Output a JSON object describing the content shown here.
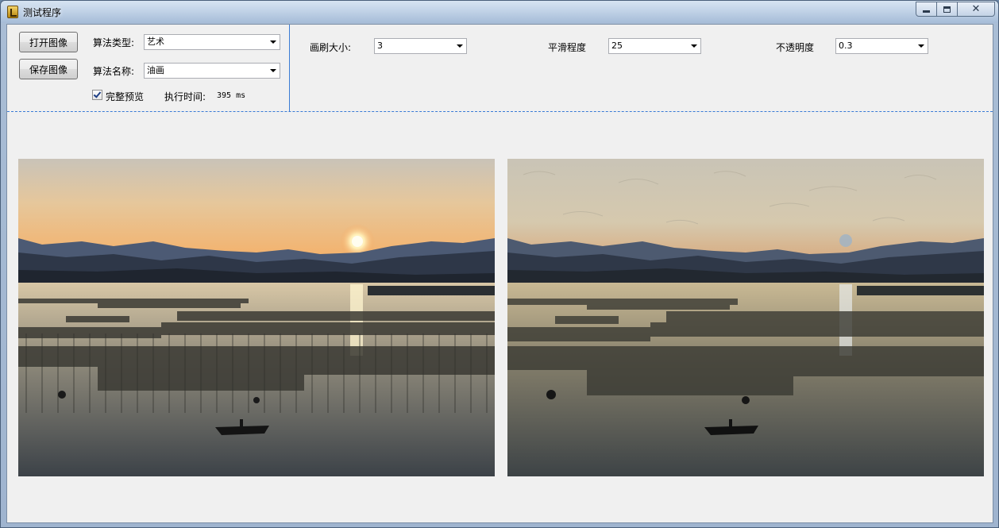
{
  "window": {
    "title": "测试程序"
  },
  "toolbar": {
    "open_button": "打开图像",
    "save_button": "保存图像",
    "algo_type_label": "算法类型:",
    "algo_type_value": "艺术",
    "algo_name_label": "算法名称:",
    "algo_name_value": "油画",
    "full_preview_label": "完整预览",
    "full_preview_checked": true,
    "exec_time_label": "执行时间:",
    "exec_time_value": "395 ms"
  },
  "params": {
    "brush_size_label": "画刷大小:",
    "brush_size_value": "3",
    "smoothness_label": "平滑程度",
    "smoothness_value": "25",
    "opacity_label": "不透明度",
    "opacity_value": "0.3"
  },
  "icons": {
    "app": "app-icon",
    "minimize": "minimize-icon",
    "maximize": "maximize-icon",
    "close": "close-icon",
    "dropdown": "chevron-down-icon",
    "check": "checkmark-icon"
  }
}
